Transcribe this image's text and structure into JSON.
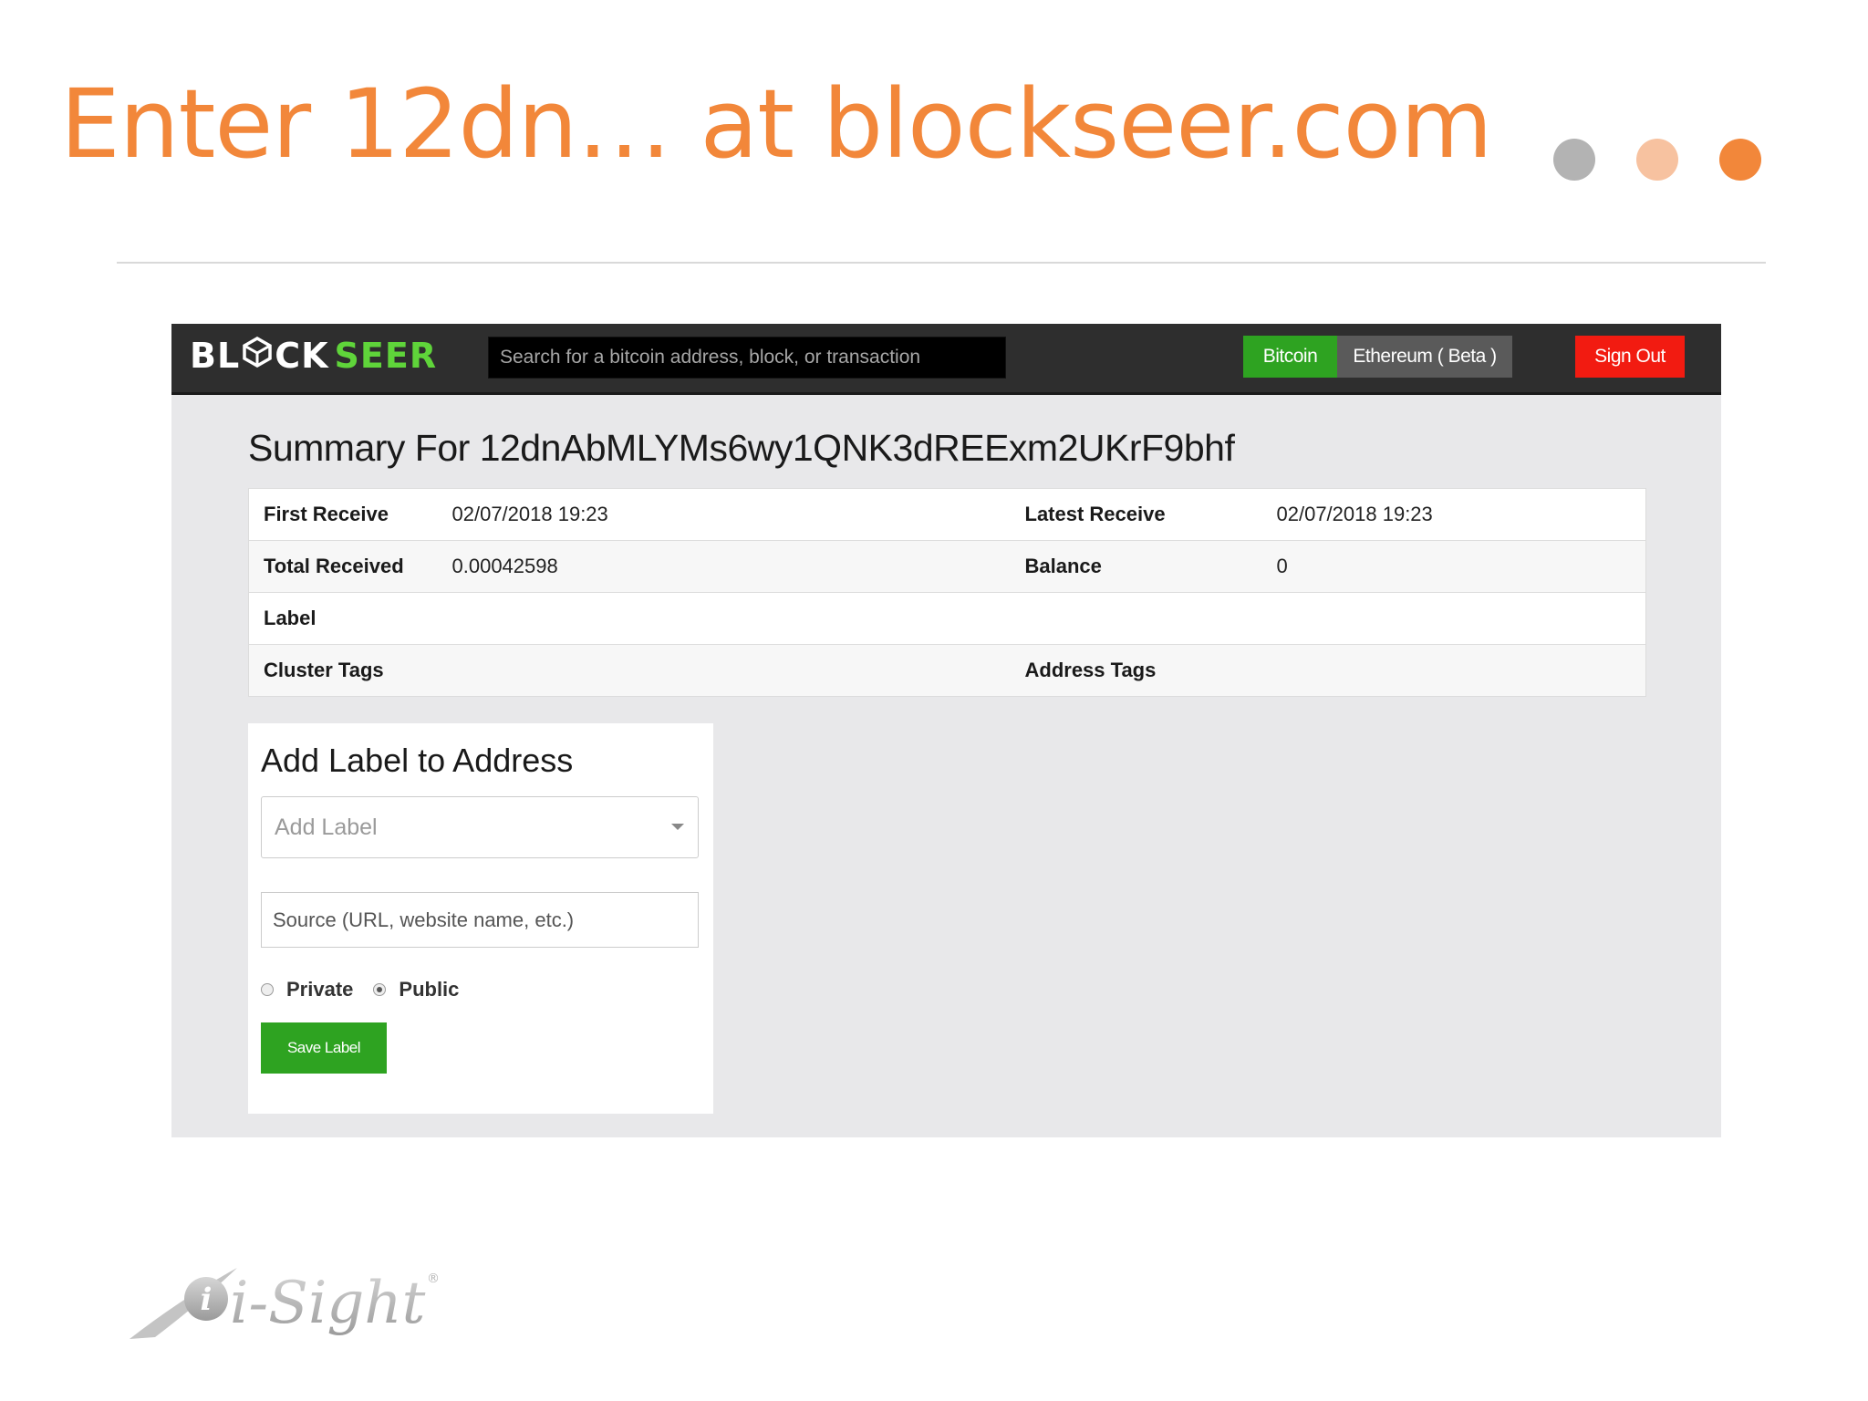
{
  "slide": {
    "title": "Enter 12dn… at blockseer.com",
    "title_color": "#f2873a",
    "dot_colors": [
      "#b3b3b3",
      "#f7c2a0",
      "#f2873a"
    ]
  },
  "app": {
    "logo": {
      "part1": "BL",
      "part2": "CK",
      "part3": "SEER",
      "accent_color": "#5fd43a"
    },
    "search": {
      "placeholder": "Search for a bitcoin address, block, or transaction"
    },
    "nav": {
      "bitcoin_label": "Bitcoin",
      "ethereum_label": "Ethereum ( Beta )",
      "signout_label": "Sign Out"
    },
    "summary": {
      "title": "Summary For 12dnAbMLYMs6wy1QNK3dREExm2UKrF9bhf",
      "rows": [
        {
          "label1": "First Receive",
          "value1": "02/07/2018 19:23",
          "label2": "Latest Receive",
          "value2": "02/07/2018 19:23"
        },
        {
          "label1": "Total Received",
          "value1": "0.00042598",
          "label2": "Balance",
          "value2": "0"
        },
        {
          "label1": "Label",
          "value1": "",
          "label2": "",
          "value2": ""
        },
        {
          "label1": "Cluster Tags",
          "value1": "",
          "label2": "Address Tags",
          "value2": ""
        }
      ]
    },
    "add_label": {
      "title": "Add Label to Address",
      "select_placeholder": "Add Label",
      "source_placeholder": "Source (URL, website name, etc.)",
      "radio_private": "Private",
      "radio_public": "Public",
      "selected_visibility": "Public",
      "save_label": "Save Label"
    }
  },
  "footer_logo": {
    "text": "i-Sight",
    "mark": "®"
  }
}
